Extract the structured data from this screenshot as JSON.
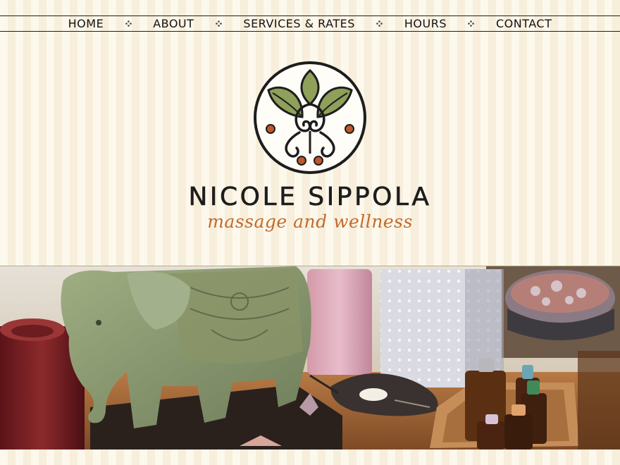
{
  "nav": {
    "items": [
      {
        "label": "HOME"
      },
      {
        "label": "ABOUT"
      },
      {
        "label": "SERVICES & RATES"
      },
      {
        "label": "HOURS"
      },
      {
        "label": "CONTACT"
      }
    ],
    "separator_icon": "four-dot-flourish-icon"
  },
  "brand": {
    "name": "NICOLE SIPPOLA",
    "tagline": "massage and wellness",
    "logo_icon": "lotus-leaf-emblem-icon"
  },
  "hero": {
    "image_description_icon": "spa-still-life-photo"
  },
  "colors": {
    "background": "#fdf6e7",
    "text": "#111111",
    "tagline": "#c06b2d",
    "leaf_green": "#8fa05a",
    "accent_orange": "#c0582a"
  }
}
